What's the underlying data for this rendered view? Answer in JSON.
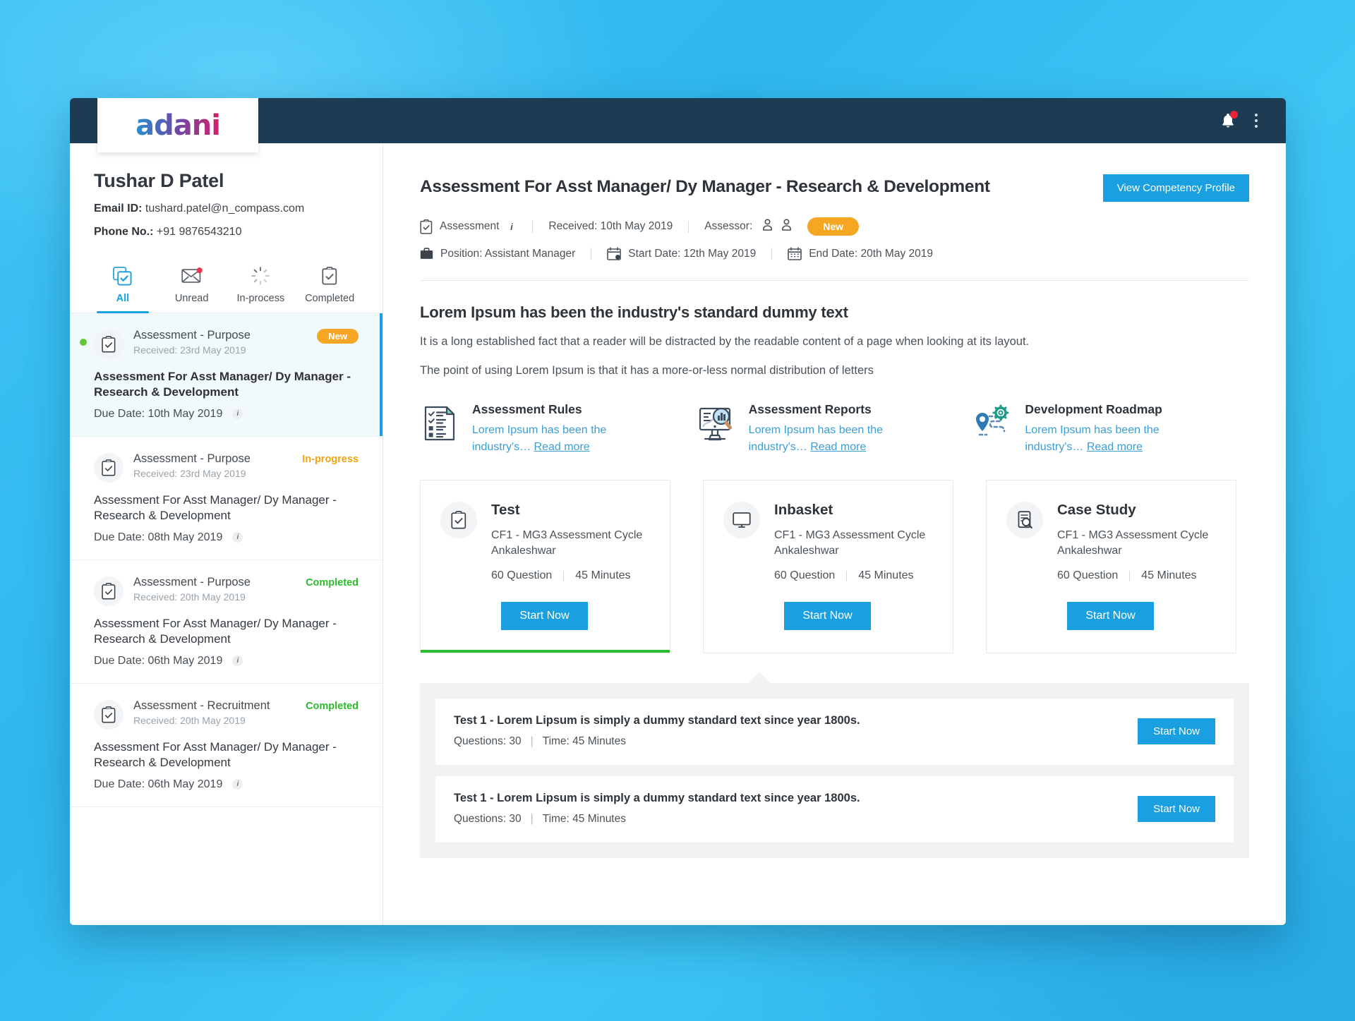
{
  "brand": {
    "logo_text": "adani"
  },
  "topbar": {
    "bell_icon": "bell-icon",
    "menu_icon": "kebab-menu-icon"
  },
  "profile": {
    "name": "Tushar D Patel",
    "email_label": "Email ID:",
    "email_value": "tushard.patel@n_compass.com",
    "phone_label": "Phone No.:",
    "phone_value": "+91 9876543210"
  },
  "tabs": [
    {
      "label": "All",
      "icon": "copy-check-icon",
      "active": true,
      "badge": ""
    },
    {
      "label": "Unread",
      "icon": "envelope-icon",
      "active": false,
      "badge": "1"
    },
    {
      "label": "In-process",
      "icon": "spinner-icon",
      "active": false,
      "badge": ""
    },
    {
      "label": "Completed",
      "icon": "clipboard-check-icon",
      "active": false,
      "badge": ""
    }
  ],
  "list": [
    {
      "purpose": "Assessment - Purpose",
      "received": "Received: 23rd May 2019",
      "status": "New",
      "status_kind": "new",
      "title": "Assessment For Asst Manager/ Dy Manager - Research & Development",
      "due": "Due Date: 10th May 2019",
      "selected": true,
      "unread": true
    },
    {
      "purpose": "Assessment - Purpose",
      "received": "Received: 23rd May 2019",
      "status": "In-progress",
      "status_kind": "inprogress",
      "title": "Assessment For Asst Manager/ Dy Manager - Research & Development",
      "due": "Due Date: 08th May 2019",
      "selected": false,
      "unread": false
    },
    {
      "purpose": "Assessment - Purpose",
      "received": "Received: 20th May 2019",
      "status": "Completed",
      "status_kind": "completed",
      "title": "Assessment For Asst Manager/ Dy Manager - Research & Development",
      "due": "Due Date: 06th May 2019",
      "selected": false,
      "unread": false
    },
    {
      "purpose": "Assessment - Recruitment",
      "received": "Received: 20th May 2019",
      "status": "Completed",
      "status_kind": "completed",
      "title": "Assessment For Asst Manager/ Dy Manager - Research & Development",
      "due": "Due Date: 06th May 2019",
      "selected": false,
      "unread": false
    }
  ],
  "main": {
    "title": "Assessment For Asst Manager/ Dy Manager - Research & Development",
    "competency_button": "View Competency Profile",
    "meta": {
      "type": "Assessment",
      "received": "Received: 10th May 2019",
      "assessor_label": "Assessor:",
      "badge": "New",
      "position": "Position: Assistant Manager",
      "start_date": "Start Date: 12th May 2019",
      "end_date": "End Date: 20th May 2019"
    },
    "lorem_heading": "Lorem Ipsum has been the industry's standard dummy text",
    "lorem_p1": "It is a long established fact that a reader will be distracted by the readable content of a page when looking at its layout.",
    "lorem_p2": "The point of using Lorem Ipsum is that it has a more-or-less normal distribution of letters"
  },
  "info_blocks": [
    {
      "title": "Assessment Rules",
      "text": "Lorem Ipsum has been the industry's…",
      "link": "Read more",
      "icon": "rules-document-icon"
    },
    {
      "title": "Assessment Reports",
      "text": "Lorem Ipsum has been the industry's…",
      "link": "Read more",
      "icon": "report-monitor-icon"
    },
    {
      "title": "Development Roadmap",
      "text": "Lorem Ipsum has been the industry's…",
      "link": "Read more",
      "icon": "roadmap-pin-icon"
    }
  ],
  "cards": [
    {
      "title": "Test",
      "icon": "clipboard-check-icon",
      "desc": "CF1 - MG3 Assessment Cycle Ankaleshwar",
      "questions": "60 Question",
      "minutes": "45 Minutes",
      "button": "Start Now",
      "progress": true
    },
    {
      "title": "Inbasket",
      "icon": "monitor-icon",
      "desc": "CF1 - MG3 Assessment Cycle Ankaleshwar",
      "questions": "60 Question",
      "minutes": "45 Minutes",
      "button": "Start Now",
      "progress": false
    },
    {
      "title": "Case Study",
      "icon": "document-search-icon",
      "desc": "CF1 - MG3 Assessment Cycle Ankaleshwar",
      "questions": "60 Question",
      "minutes": "45 Minutes",
      "button": "Start Now",
      "progress": false
    }
  ],
  "tests": [
    {
      "title": "Test 1 - Lorem Lipsum is simply a dummy standard text since year 1800s.",
      "questions": "Questions: 30",
      "time": "Time: 45 Minutes",
      "button": "Start Now"
    },
    {
      "title": "Test 1 - Lorem Lipsum is simply a dummy standard text since year 1800s.",
      "questions": "Questions: 30",
      "time": "Time: 45 Minutes",
      "button": "Start Now"
    }
  ],
  "colors": {
    "accent": "#1a9fe0",
    "topbar": "#1d3c54",
    "warning": "#f5a623",
    "success": "#2dbb2d"
  }
}
